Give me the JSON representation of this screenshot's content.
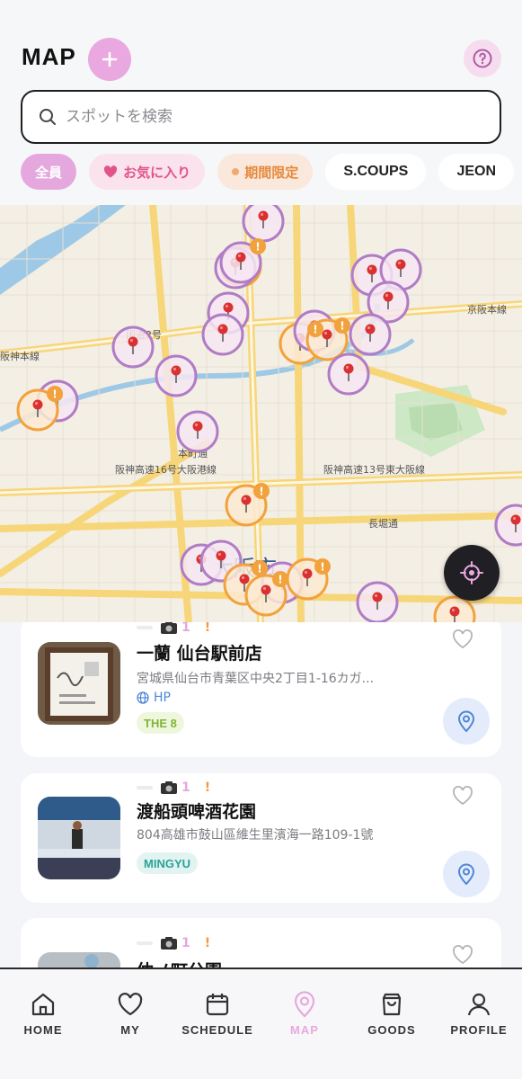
{
  "header": {
    "title": "MAP"
  },
  "search": {
    "placeholder": "スポットを検索"
  },
  "filters": {
    "all": "全員",
    "favorites": "お気に入り",
    "limited": "期間限定",
    "members": [
      "S.COUPS",
      "JEON"
    ]
  },
  "map": {
    "city_label": "大阪市"
  },
  "spots": [
    {
      "count": "1",
      "alert": "!",
      "name": "一蘭 仙台駅前店",
      "address": "宮城県仙台市青葉区中央2丁目1-16カガ...",
      "link": "HP",
      "tag": "THE 8"
    },
    {
      "count": "1",
      "alert": "!",
      "name": "渡船頭啤酒花園",
      "address": "804高雄市鼓山區維生里濱海一路109-1號",
      "tag": "MINGYU"
    },
    {
      "count": "1",
      "alert": "!",
      "name": "仲ノ町公園"
    }
  ],
  "tabs": [
    {
      "label": "HOME"
    },
    {
      "label": "MY"
    },
    {
      "label": "SCHEDULE"
    },
    {
      "label": "MAP"
    },
    {
      "label": "GOODS"
    },
    {
      "label": "PROFILE"
    }
  ],
  "colors": {
    "accent": "#e9a8df",
    "pin_purple": "#b07cc6",
    "pin_orange": "#f2a23c",
    "tag_green": "#8cc63f",
    "tag_teal": "#2aa198"
  }
}
